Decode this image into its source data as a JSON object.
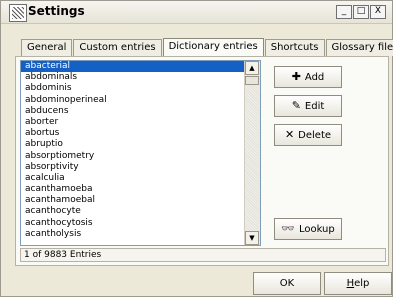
{
  "window": {
    "title": "Settings",
    "buttons": {
      "min": "_",
      "max": "□",
      "close": "X"
    }
  },
  "tabs": [
    {
      "label": "General"
    },
    {
      "label": "Custom entries"
    },
    {
      "label": "Dictionary entries"
    },
    {
      "label": "Shortcuts"
    },
    {
      "label": "Glossary files"
    }
  ],
  "list": {
    "items": [
      "abacterial",
      "abdominals",
      "abdominis",
      "abdominoperineal",
      "abducens",
      "aborter",
      "abortus",
      "abruptio",
      "absorptiometry",
      "absorptivity",
      "acalculia",
      "acanthamoeba",
      "acanthamoebal",
      "acanthocyte",
      "acanthocytosis",
      "acantholysis"
    ],
    "selected_index": 0
  },
  "actions": {
    "add": "Add",
    "edit": "Edit",
    "delete": "Delete",
    "lookup": "Lookup"
  },
  "status": "1 of 9883 Entries",
  "footer": {
    "ok": "OK",
    "help_first": "H",
    "help_rest": "elp"
  }
}
